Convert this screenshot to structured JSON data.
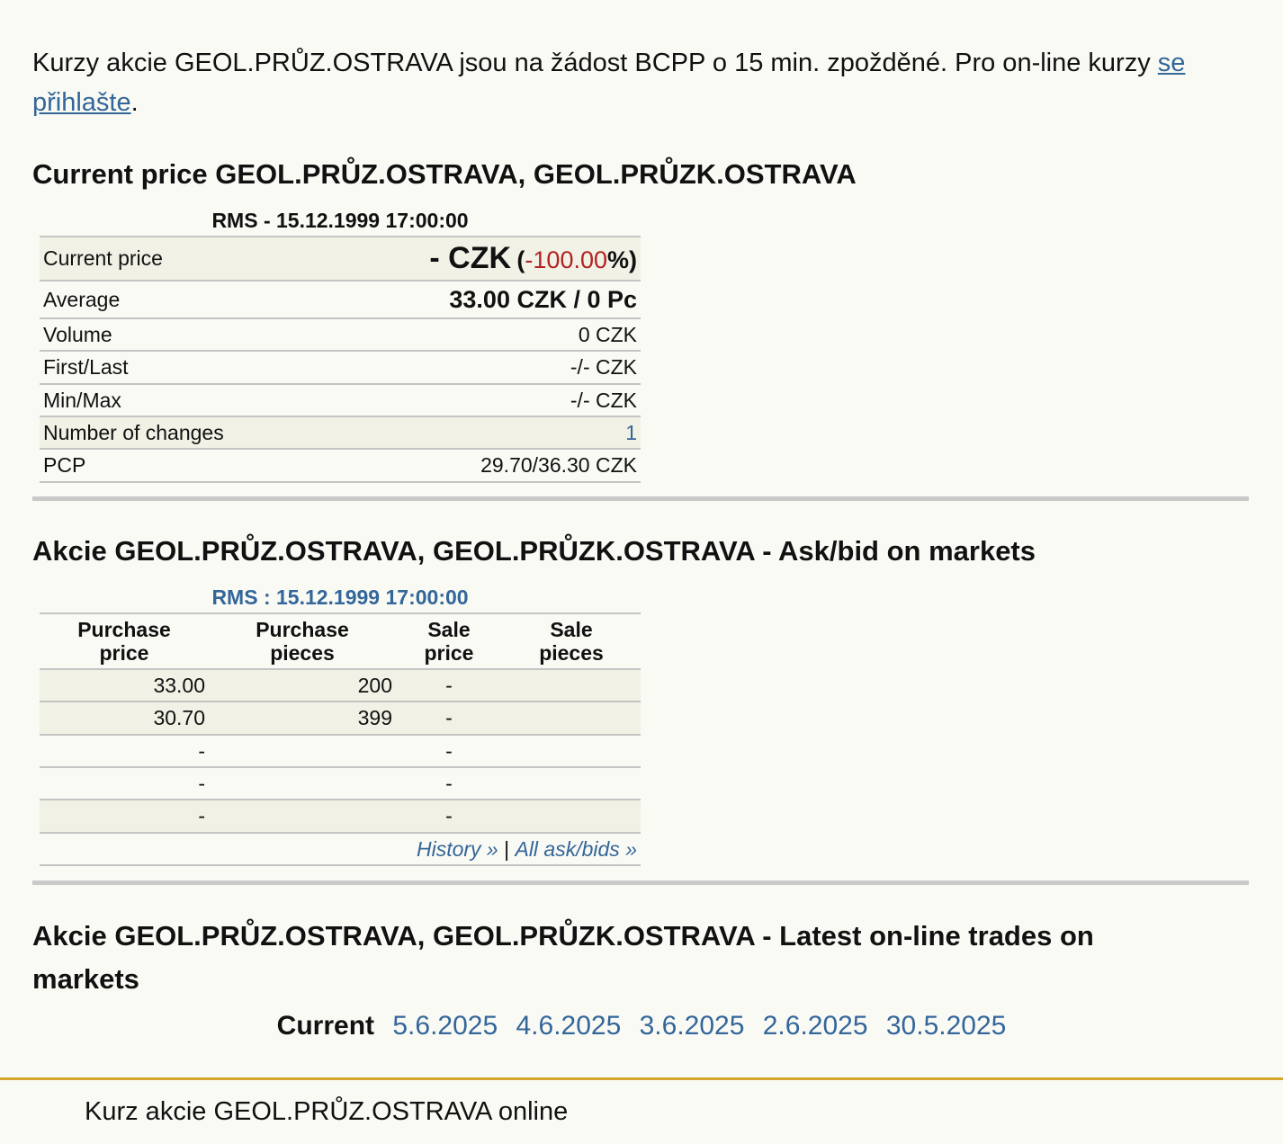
{
  "notice": {
    "text": "Kurzy akcie GEOL.PRŮZ.OSTRAVA jsou na žádost BCPP o 15 min. zpožděné. Pro on-line kurzy ",
    "link": "se přihlašte",
    "end": "."
  },
  "price_section": {
    "heading": "Current price GEOL.PRŮZ.OSTRAVA, GEOL.PRŮZK.OSTRAVA",
    "caption": "RMS - 15.12.1999 17:00:00",
    "current_label": "Current price",
    "current_value": "- CZK",
    "change_open": "(",
    "change_value": "-100.00",
    "change_close": "%)",
    "average_label": "Average",
    "average_value": "33.00 CZK / 0 Pc",
    "rows": [
      {
        "label": "Volume",
        "value": "0 CZK"
      },
      {
        "label": "First/Last",
        "value": "-/- CZK"
      },
      {
        "label": "Min/Max",
        "value": "-/- CZK"
      },
      {
        "label": "Number of changes",
        "value": "1"
      },
      {
        "label": "PCP",
        "value": "29.70/36.30 CZK"
      }
    ]
  },
  "askbid_section": {
    "heading": "Akcie GEOL.PRŮZ.OSTRAVA, GEOL.PRŮZK.OSTRAVA - Ask/bid on markets",
    "caption": "RMS : 15.12.1999 17:00:00",
    "headers": [
      [
        "Purchase",
        "price"
      ],
      [
        "Purchase",
        "pieces"
      ],
      [
        "Sale",
        "price"
      ],
      [
        "Sale",
        "pieces"
      ]
    ],
    "rows": [
      [
        "33.00",
        "200",
        "-",
        ""
      ],
      [
        "30.70",
        "399",
        "-",
        ""
      ],
      [
        "-",
        "",
        "-",
        ""
      ],
      [
        "-",
        "",
        "-",
        ""
      ],
      [
        "-",
        "",
        "-",
        ""
      ]
    ],
    "history_link": "History »",
    "separator": "|",
    "all_link": "All ask/bids »"
  },
  "trades_section": {
    "heading_line1": "Akcie GEOL.PRŮZ.OSTRAVA, GEOL.PRŮZK.OSTRAVA - Latest on-line trades on",
    "heading_line2": "markets",
    "current_tab": "Current",
    "dates": [
      "5.6.2025",
      "4.6.2025",
      "3.6.2025",
      "2.6.2025",
      "30.5.2025"
    ]
  },
  "footer": {
    "text": "Kurz akcie GEOL.PRŮZ.OSTRAVA online",
    "accent_color": "#d4a72c"
  }
}
